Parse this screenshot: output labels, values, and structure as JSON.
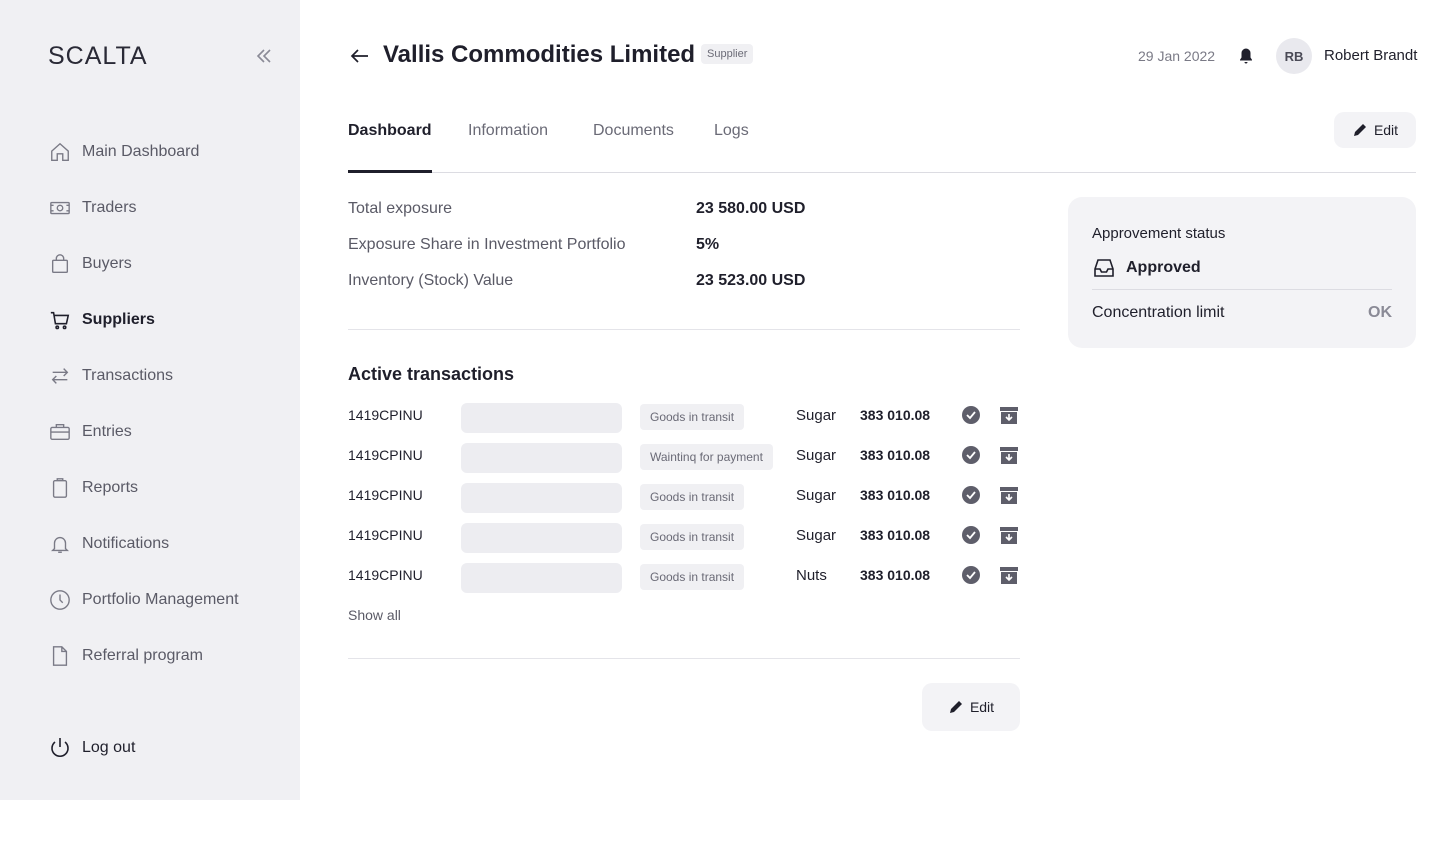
{
  "sidebar": {
    "logo": "SCALTA",
    "items": [
      {
        "label": "Main Dashboard",
        "icon": "home-icon"
      },
      {
        "label": "Traders",
        "icon": "banknote-icon"
      },
      {
        "label": "Buyers",
        "icon": "shopping-bag-icon"
      },
      {
        "label": "Suppliers",
        "icon": "cart-icon",
        "active": true
      },
      {
        "label": "Transactions",
        "icon": "arrows-exchange-icon"
      },
      {
        "label": "Entries",
        "icon": "briefcase-icon"
      },
      {
        "label": "Reports",
        "icon": "clipboard-icon"
      },
      {
        "label": "Notifications",
        "icon": "bell-icon"
      },
      {
        "label": "Portfolio Management",
        "icon": "clock-icon"
      },
      {
        "label": "Referral program",
        "icon": "file-icon"
      }
    ],
    "logout": "Log out"
  },
  "header": {
    "title": "Vallis Commodities Limited",
    "badge": "Supplier",
    "date": "29 Jan 2022",
    "avatar_initials": "RB",
    "user_name": "Robert Brandt"
  },
  "tabs": [
    {
      "label": "Dashboard",
      "active": true
    },
    {
      "label": "Information"
    },
    {
      "label": "Documents"
    },
    {
      "label": "Logs"
    }
  ],
  "edit_label": "Edit",
  "summary": [
    {
      "label": "Total exposure",
      "value": "23 580.00 USD"
    },
    {
      "label": "Exposure Share in Investment Portfolio",
      "value": "5%"
    },
    {
      "label": "Inventory (Stock) Value",
      "value": "23 523.00 USD"
    }
  ],
  "transactions": {
    "title": "Active transactions",
    "rows": [
      {
        "id": "1419CPINU",
        "status": "Goods in transit",
        "product": "Sugar",
        "amount": "383 010.08"
      },
      {
        "id": "1419CPINU",
        "status": "Waintinq for payment",
        "product": "Sugar",
        "amount": "383 010.08"
      },
      {
        "id": "1419CPINU",
        "status": "Goods in transit",
        "product": "Sugar",
        "amount": "383 010.08"
      },
      {
        "id": "1419CPINU",
        "status": "Goods in transit",
        "product": "Sugar",
        "amount": "383 010.08"
      },
      {
        "id": "1419CPINU",
        "status": "Goods in transit",
        "product": "Nuts",
        "amount": "383 010.08"
      }
    ],
    "show_all": "Show all"
  },
  "status_card": {
    "label": "Approvement status",
    "status": "Approved",
    "limit_label": "Concentration limit",
    "limit_value": "OK"
  },
  "colors": {
    "sidebar_bg": "#f0f0f3",
    "text_primary": "#1f1f2b",
    "text_secondary": "#5a5a66",
    "icon_gray": "#6a6a76"
  }
}
